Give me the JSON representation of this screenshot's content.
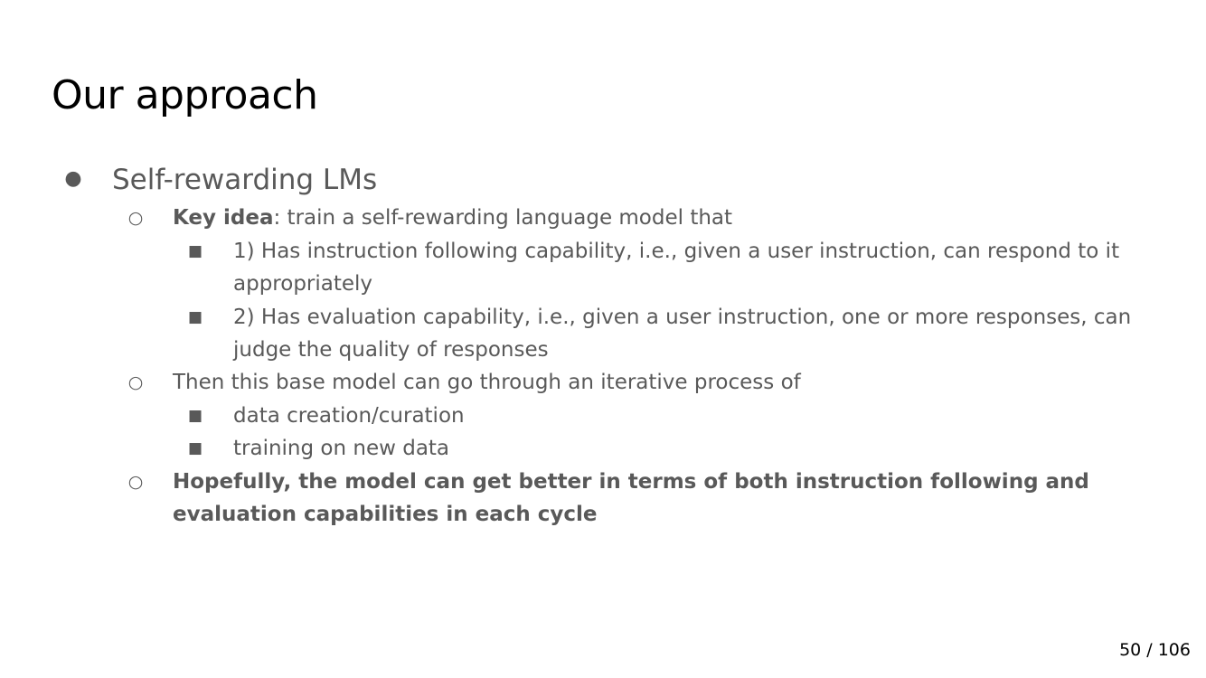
{
  "slide": {
    "title": "Our approach",
    "bullets": {
      "b1": {
        "symbol": "●",
        "text": "Self-rewarding LMs"
      },
      "b1_1": {
        "symbol": "○",
        "bold": "Key idea",
        "rest": ": train a self-rewarding language model that"
      },
      "b1_1_1": {
        "symbol": "■",
        "line1": "1) Has instruction following capability, i.e., given a user instruction, can respond to it",
        "line2": "appropriately"
      },
      "b1_1_2": {
        "symbol": "■",
        "line1": "2) Has evaluation capability, i.e.,  given a user instruction, one or more responses, can",
        "line2": "judge the quality of responses"
      },
      "b1_2": {
        "symbol": "○",
        "text": "Then this base model can go through an iterative process of"
      },
      "b1_2_1": {
        "symbol": "■",
        "text": "data creation/curation"
      },
      "b1_2_2": {
        "symbol": "■",
        "text": "training on new data"
      },
      "b1_3": {
        "symbol": "○",
        "line1": "Hopefully, the model can get better in terms of both instruction following and",
        "line2": "evaluation capabilities in each cycle"
      }
    }
  },
  "page_number": "50 / 106"
}
